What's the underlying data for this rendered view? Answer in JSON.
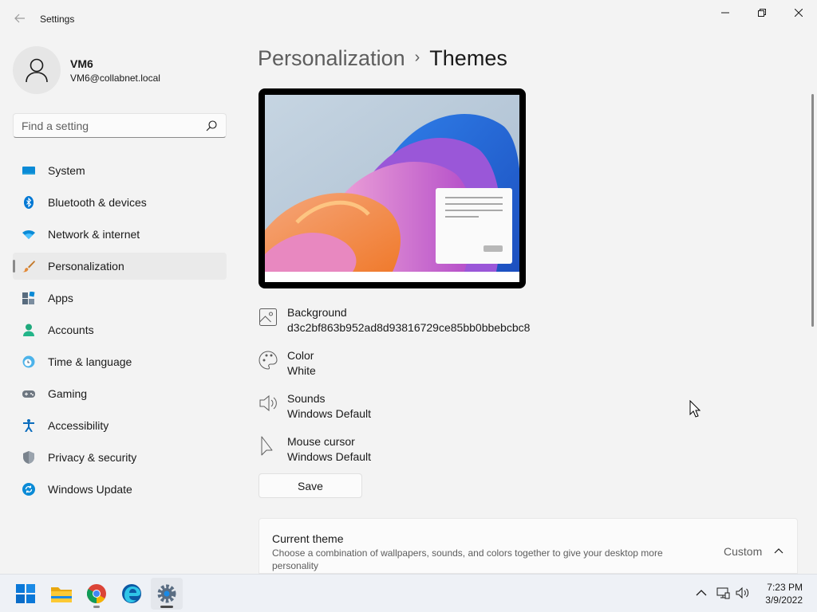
{
  "window": {
    "title": "Settings",
    "back_icon": "back-arrow-icon",
    "controls": [
      "minimize-icon",
      "maximize-icon",
      "close-icon"
    ]
  },
  "user": {
    "name": "VM6",
    "email": "VM6@collabnet.local"
  },
  "search": {
    "placeholder": "Find a setting",
    "value": ""
  },
  "sidebar": {
    "items": [
      {
        "label": "System",
        "icon": "monitor-icon",
        "active": false
      },
      {
        "label": "Bluetooth & devices",
        "icon": "bluetooth-icon",
        "active": false
      },
      {
        "label": "Network & internet",
        "icon": "wifi-icon",
        "active": false
      },
      {
        "label": "Personalization",
        "icon": "paintbrush-icon",
        "active": true
      },
      {
        "label": "Apps",
        "icon": "apps-icon",
        "active": false
      },
      {
        "label": "Accounts",
        "icon": "person-icon",
        "active": false
      },
      {
        "label": "Time & language",
        "icon": "globe-clock-icon",
        "active": false
      },
      {
        "label": "Gaming",
        "icon": "gamepad-icon",
        "active": false
      },
      {
        "label": "Accessibility",
        "icon": "accessibility-icon",
        "active": false
      },
      {
        "label": "Privacy & security",
        "icon": "shield-icon",
        "active": false
      },
      {
        "label": "Windows Update",
        "icon": "refresh-icon",
        "active": false
      }
    ]
  },
  "breadcrumb": {
    "parent": "Personalization",
    "separator": "›",
    "current": "Themes"
  },
  "theme_properties": [
    {
      "label": "Background",
      "value": "d3c2bf863b952ad8d93816729ce85bb0bbebcbc8",
      "icon": "image-icon"
    },
    {
      "label": "Color",
      "value": "White",
      "icon": "palette-icon"
    },
    {
      "label": "Sounds",
      "value": "Windows Default",
      "icon": "speaker-icon"
    },
    {
      "label": "Mouse cursor",
      "value": "Windows Default",
      "icon": "cursor-icon"
    }
  ],
  "save_button": "Save",
  "current_theme": {
    "title": "Current theme",
    "description": "Choose a combination of wallpapers, sounds, and colors together to give your desktop more personality",
    "value": "Custom",
    "expanded": true
  },
  "taskbar": {
    "apps": [
      {
        "name": "Start",
        "icon": "windows-start-icon"
      },
      {
        "name": "File Explorer",
        "icon": "folder-icon"
      },
      {
        "name": "Chrome",
        "icon": "chrome-icon"
      },
      {
        "name": "Edge",
        "icon": "edge-icon"
      },
      {
        "name": "Settings",
        "icon": "settings-gear-icon"
      }
    ],
    "tray": [
      "chevron-up-icon",
      "network-icon",
      "volume-icon"
    ],
    "time": "7:23 PM",
    "date": "3/9/2022"
  },
  "colors": {
    "accent": "#0067c0",
    "window_bg": "#f3f3f3",
    "card_bg": "#fbfbfb",
    "taskbar_bg": "#eef1f6"
  }
}
